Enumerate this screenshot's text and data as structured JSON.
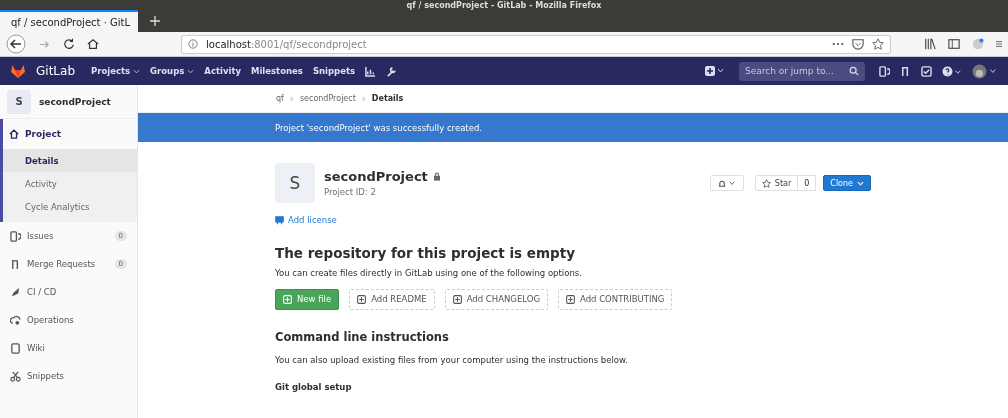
{
  "window": {
    "title": "qf / secondProject - GitLab - Mozilla Firefox"
  },
  "browser": {
    "tab": "qf / secondProject · GitL",
    "url_host": "localhost",
    "url_rest": ":8001/qf/secondproject"
  },
  "nav": {
    "brand": "GitLab",
    "items": [
      {
        "label": "Projects",
        "dropdown": true
      },
      {
        "label": "Groups",
        "dropdown": true
      },
      {
        "label": "Activity",
        "dropdown": false
      },
      {
        "label": "Milestones",
        "dropdown": false
      },
      {
        "label": "Snippets",
        "dropdown": false
      }
    ],
    "search": {
      "placeholder": "Search or jump to..."
    }
  },
  "sidebar": {
    "avatar": "S",
    "project": "secondProject",
    "section": {
      "label": "Project",
      "expanded": true,
      "children": [
        {
          "label": "Details",
          "selected": true
        },
        {
          "label": "Activity",
          "selected": false
        },
        {
          "label": "Cycle Analytics",
          "selected": false
        }
      ]
    },
    "items": [
      {
        "label": "Issues",
        "count": "0"
      },
      {
        "label": "Merge Requests",
        "count": "0"
      },
      {
        "label": "CI / CD"
      },
      {
        "label": "Operations"
      },
      {
        "label": "Wiki"
      },
      {
        "label": "Snippets"
      }
    ]
  },
  "breadcrumb": [
    "qf",
    "secondProject",
    "Details"
  ],
  "flash": "Project 'secondProject' was successfully created.",
  "project": {
    "avatar": "S",
    "name": "secondProject",
    "private": true,
    "id": "Project ID: 2",
    "star": "Star",
    "star_count": "0",
    "clone": "Clone",
    "add_license": "Add license"
  },
  "empty": {
    "title": "The repository for this project is empty",
    "text": "You can create files directly in GitLab using one of the following options.",
    "buttons": [
      {
        "label": "New file",
        "kind": "primary"
      },
      {
        "label": "Add README",
        "kind": "dashed"
      },
      {
        "label": "Add CHANGELOG",
        "kind": "dashed"
      },
      {
        "label": "Add CONTRIBUTING",
        "kind": "dashed"
      }
    ]
  },
  "cli": {
    "title": "Command line instructions",
    "text": "You can also upload existing files from your computer using the instructions below.",
    "subtitle": "Git global setup"
  }
}
